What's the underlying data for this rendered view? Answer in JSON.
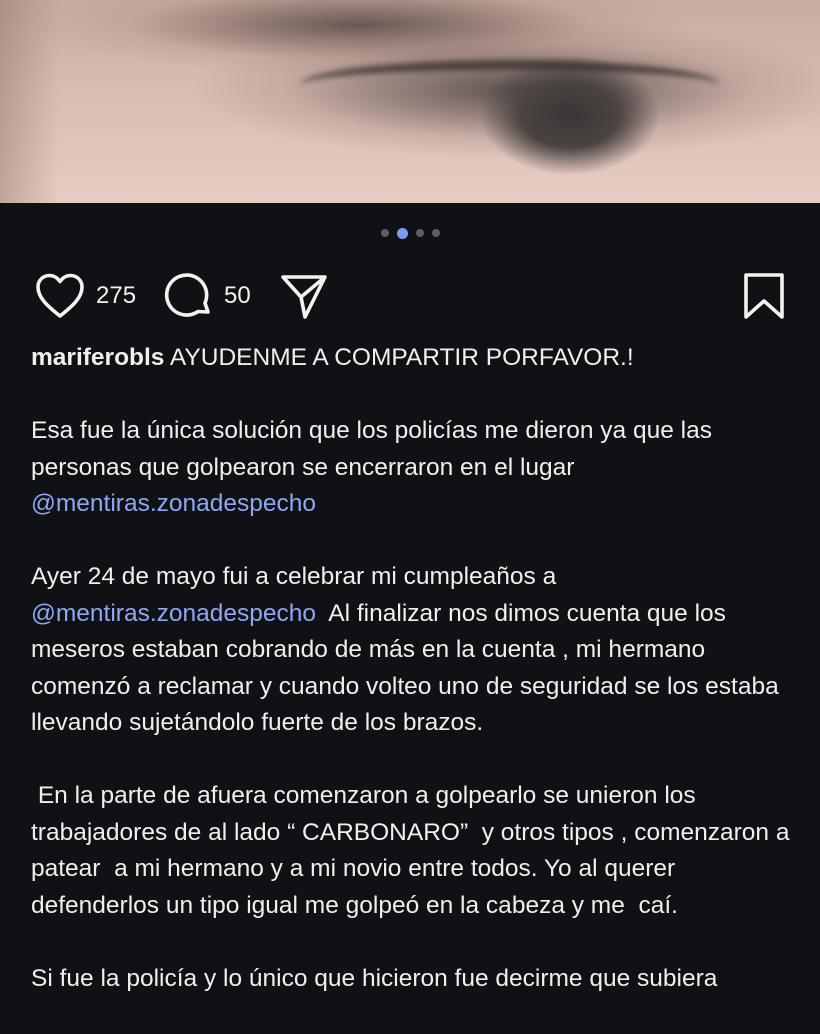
{
  "carousel": {
    "count": 4,
    "active_index": 1
  },
  "actions": {
    "likes": "275",
    "comments": "50"
  },
  "post": {
    "username": "mariferobls",
    "headline": "AYUDENME A COMPARTIR PORFAVOR.!",
    "p1_text": "Esa fue la única solución que los policías me dieron ya que las personas que golpearon se encerraron en el lugar",
    "p1_mention": "@mentiras.zonadespecho",
    "p2_a": "Ayer 24 de mayo fui a celebrar mi cumpleaños a",
    "p2_mention": "@mentiras.zonadespecho",
    "p2_b": "  Al finalizar nos dimos cuenta que los meseros estaban cobrando de más en la cuenta , mi hermano comenzó a reclamar y cuando volteo uno de seguridad se los estaba llevando sujetándolo fuerte de los brazos.",
    "p3": " En la parte de afuera comenzaron a golpearlo se unieron los trabajadores de al lado “ CARBONARO”  y otros tipos , comenzaron a patear  a mi hermano y a mi novio entre todos. Yo al querer defenderlos un tipo igual me golpeó en la cabeza y me  caí.",
    "p4": "Si fue la policía y lo único que hicieron fue decirme que subiera"
  },
  "colors": {
    "background": "#0f1115",
    "mention": "#8ea7f3",
    "active_dot": "#7a9cf0"
  },
  "icons": [
    "heart-icon",
    "comment-icon",
    "share-icon",
    "bookmark-icon"
  ]
}
